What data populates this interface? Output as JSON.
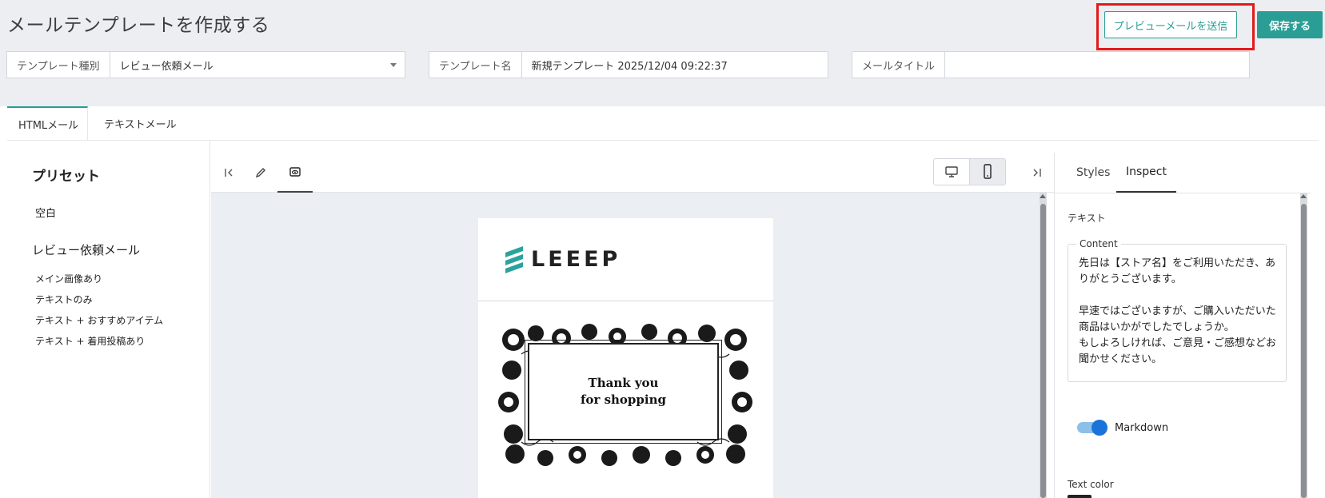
{
  "header": {
    "title": "メールテンプレートを作成する",
    "preview_button": "プレビューメールを送信",
    "save_button": "保存する"
  },
  "fields": {
    "template_type": {
      "label": "テンプレート種別",
      "value": "レビュー依頼メール"
    },
    "template_name": {
      "label": "テンプレート名",
      "value": "新規テンプレート 2025/12/04 09:22:37"
    },
    "mail_title": {
      "label": "メールタイトル",
      "value": ""
    }
  },
  "tabs": [
    {
      "label": "HTMLメール",
      "active": true
    },
    {
      "label": "テキストメール",
      "active": false
    }
  ],
  "presets": {
    "title": "プリセット",
    "blank": "空白",
    "group": "レビュー依頼メール",
    "items": [
      "メイン画像あり",
      "テキストのみ",
      "テキスト + おすすめアイテム",
      "テキスト + 着用投稿あり"
    ]
  },
  "editor": {
    "toolbar_icons": [
      "collapse-left-icon",
      "pencil-icon",
      "eye-icon"
    ],
    "devices": [
      "desktop-icon",
      "mobile-icon"
    ],
    "active_device": "mobile",
    "collapse_right_icon": "collapse-right-icon"
  },
  "mail_preview": {
    "logo_text": "LEEEP",
    "card_line1": "Thank you",
    "card_line2": "for shopping"
  },
  "inspector": {
    "tabs": [
      "Styles",
      "Inspect"
    ],
    "active_tab": "Inspect",
    "section": "テキスト",
    "content_legend": "Content",
    "content_text": "先日は【ストア名】をご利用いただき、ありがとうございます。\n\n早速ではございますが、ご購入いただいた商品はいかがでしたでしょうか。\nもしよろしければ、ご意見・ご感想などお聞かせください。",
    "markdown_label": "Markdown",
    "markdown_on": true,
    "text_color_label": "Text color"
  },
  "colors": {
    "accent": "#2a9d94",
    "highlight": "#e21a1a",
    "toggle": "#1a73d9"
  }
}
